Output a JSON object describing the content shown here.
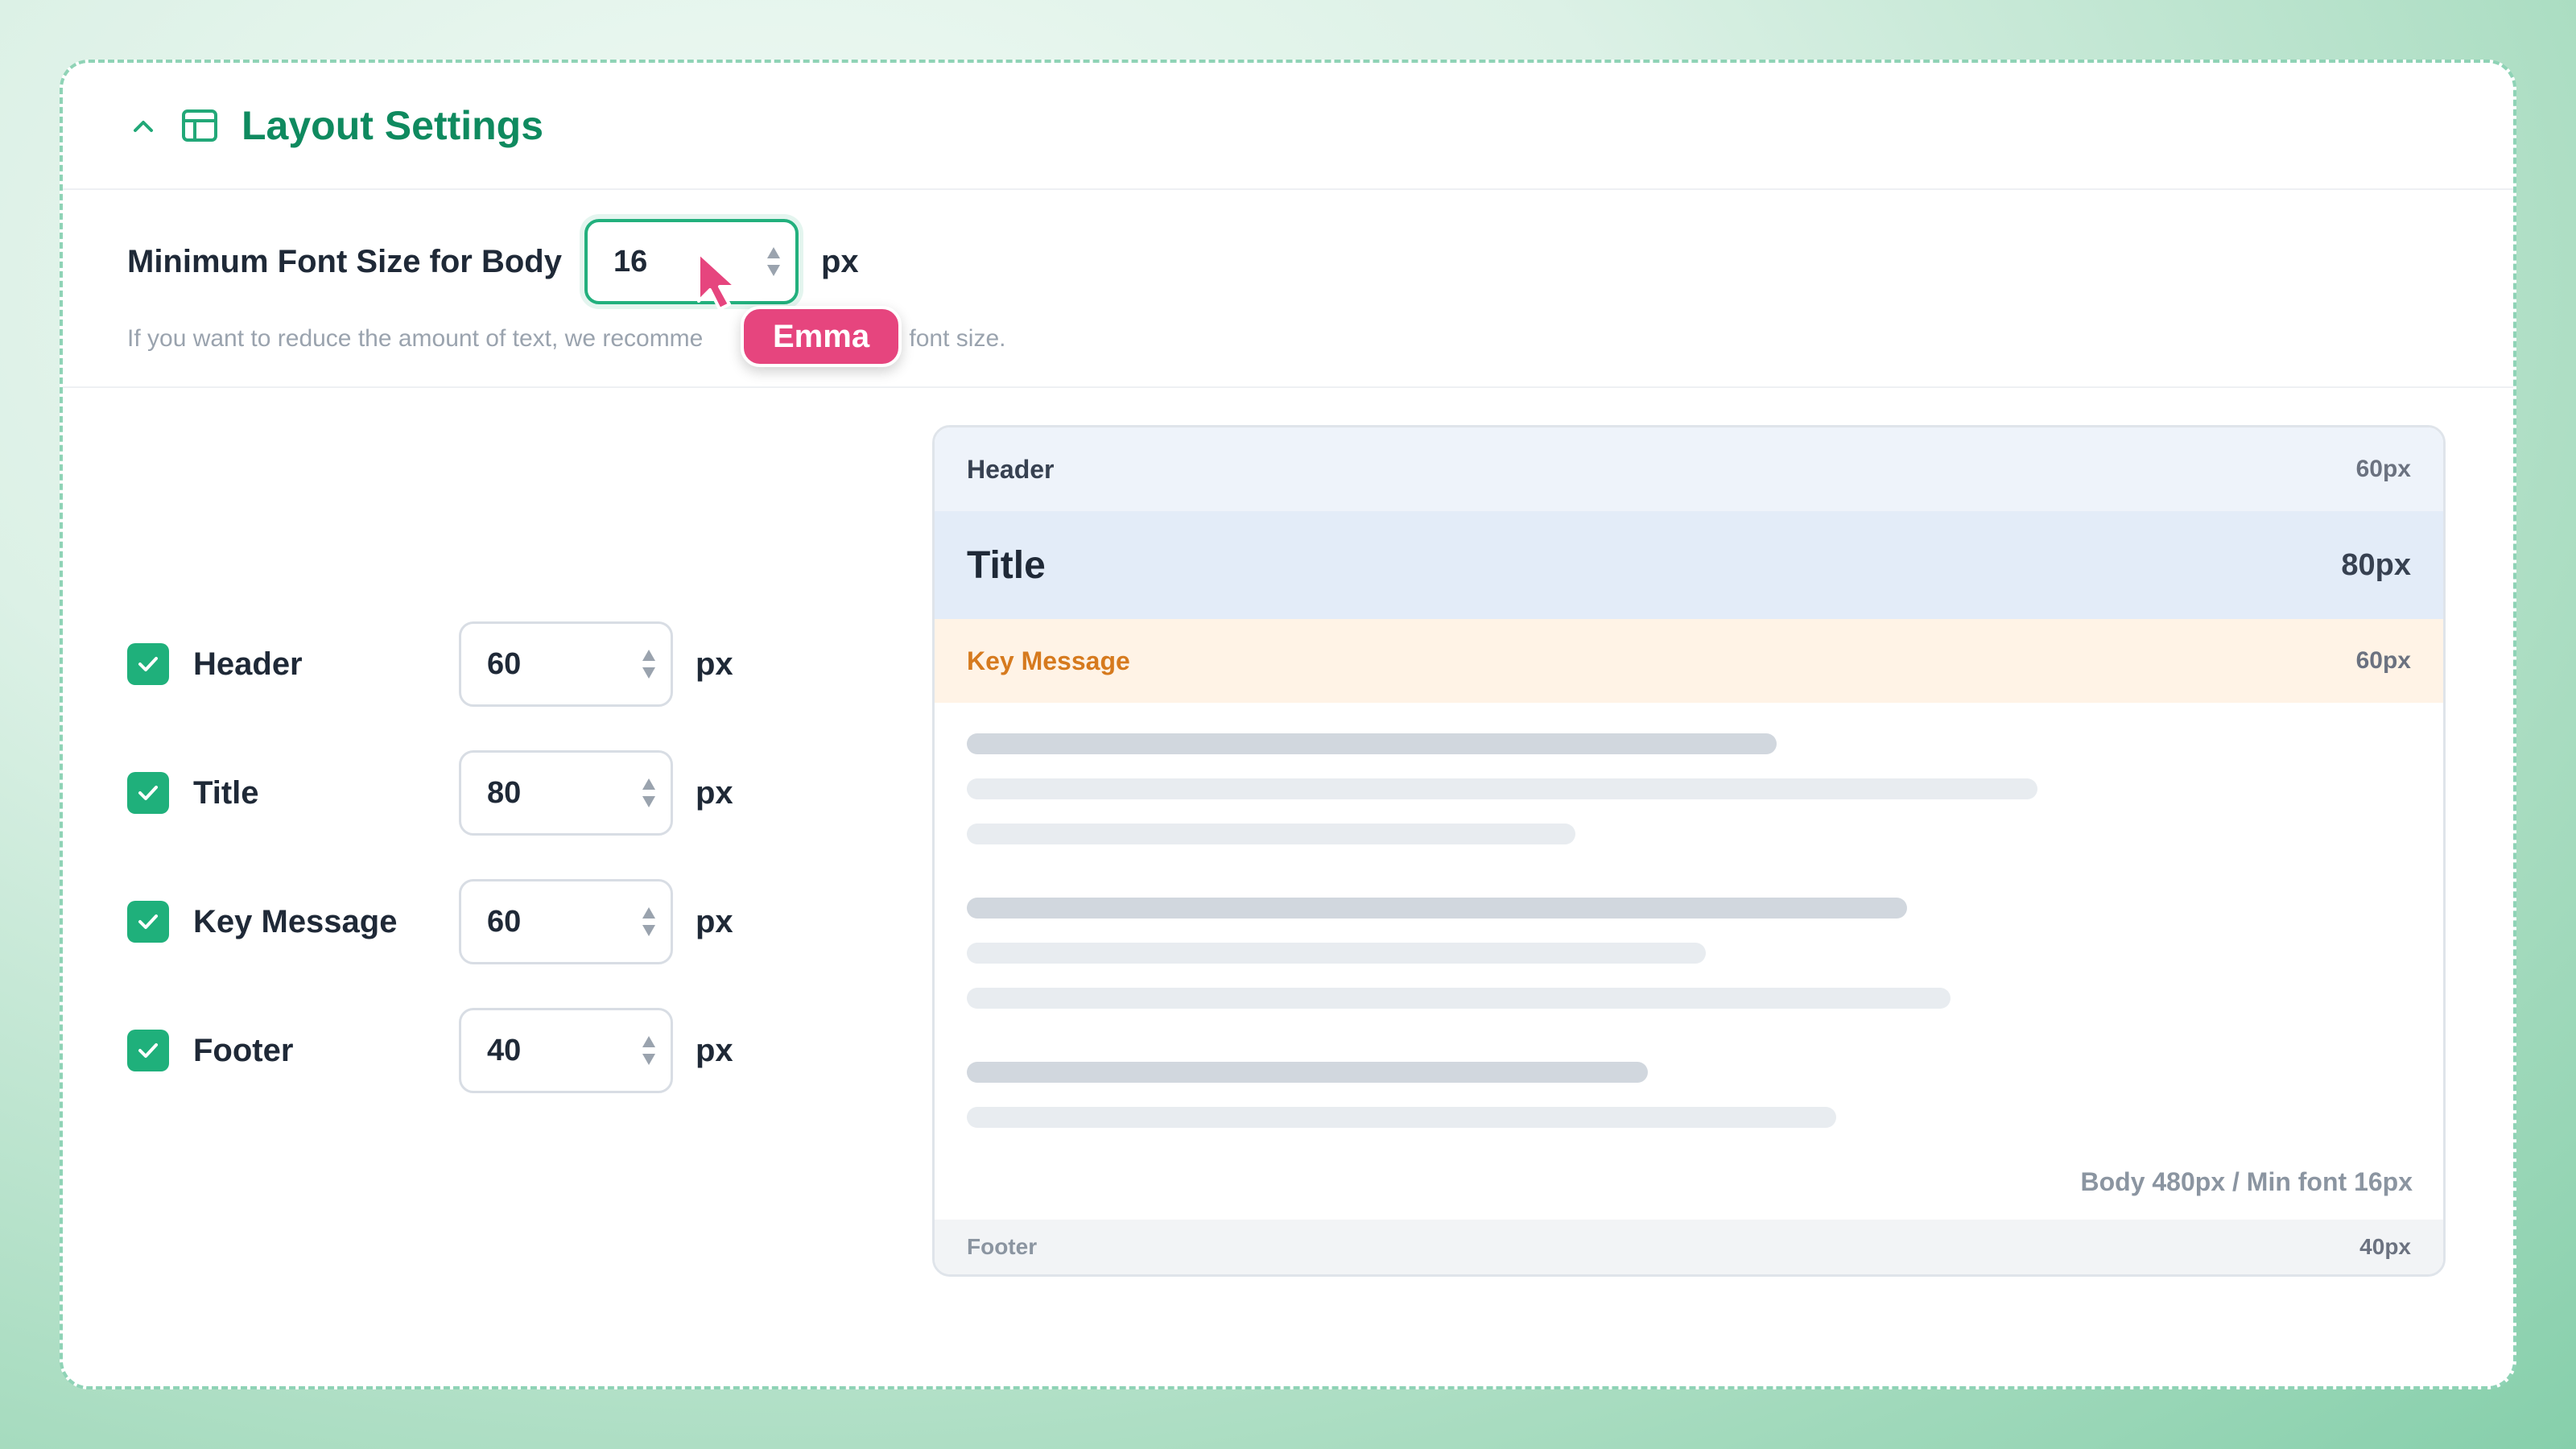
{
  "panel": {
    "title": "Layout Settings",
    "icons": {
      "collapse": "chevron-up-icon",
      "section": "layout-icon"
    },
    "accent_color": "#0f8a5f"
  },
  "min_font": {
    "label": "Minimum Font Size for Body",
    "value": "16",
    "unit": "px",
    "hint_start": "If you want to reduce the amount of text, we recomme",
    "hint_end": "the font size."
  },
  "cursor": {
    "user_name": "Emma",
    "color": "#e6457e"
  },
  "sections": [
    {
      "label": "Header",
      "value": "60",
      "unit": "px",
      "checked": true
    },
    {
      "label": "Title",
      "value": "80",
      "unit": "px",
      "checked": true
    },
    {
      "label": "Key Message",
      "value": "60",
      "unit": "px",
      "checked": true
    },
    {
      "label": "Footer",
      "value": "40",
      "unit": "px",
      "checked": true
    }
  ],
  "preview": {
    "header": {
      "label": "Header",
      "size": "60px"
    },
    "title": {
      "label": "Title",
      "size": "80px"
    },
    "key_message": {
      "label": "Key Message",
      "size": "60px"
    },
    "body_note": "Body 480px / Min font 16px",
    "footer": {
      "label": "Footer",
      "size": "40px"
    }
  }
}
